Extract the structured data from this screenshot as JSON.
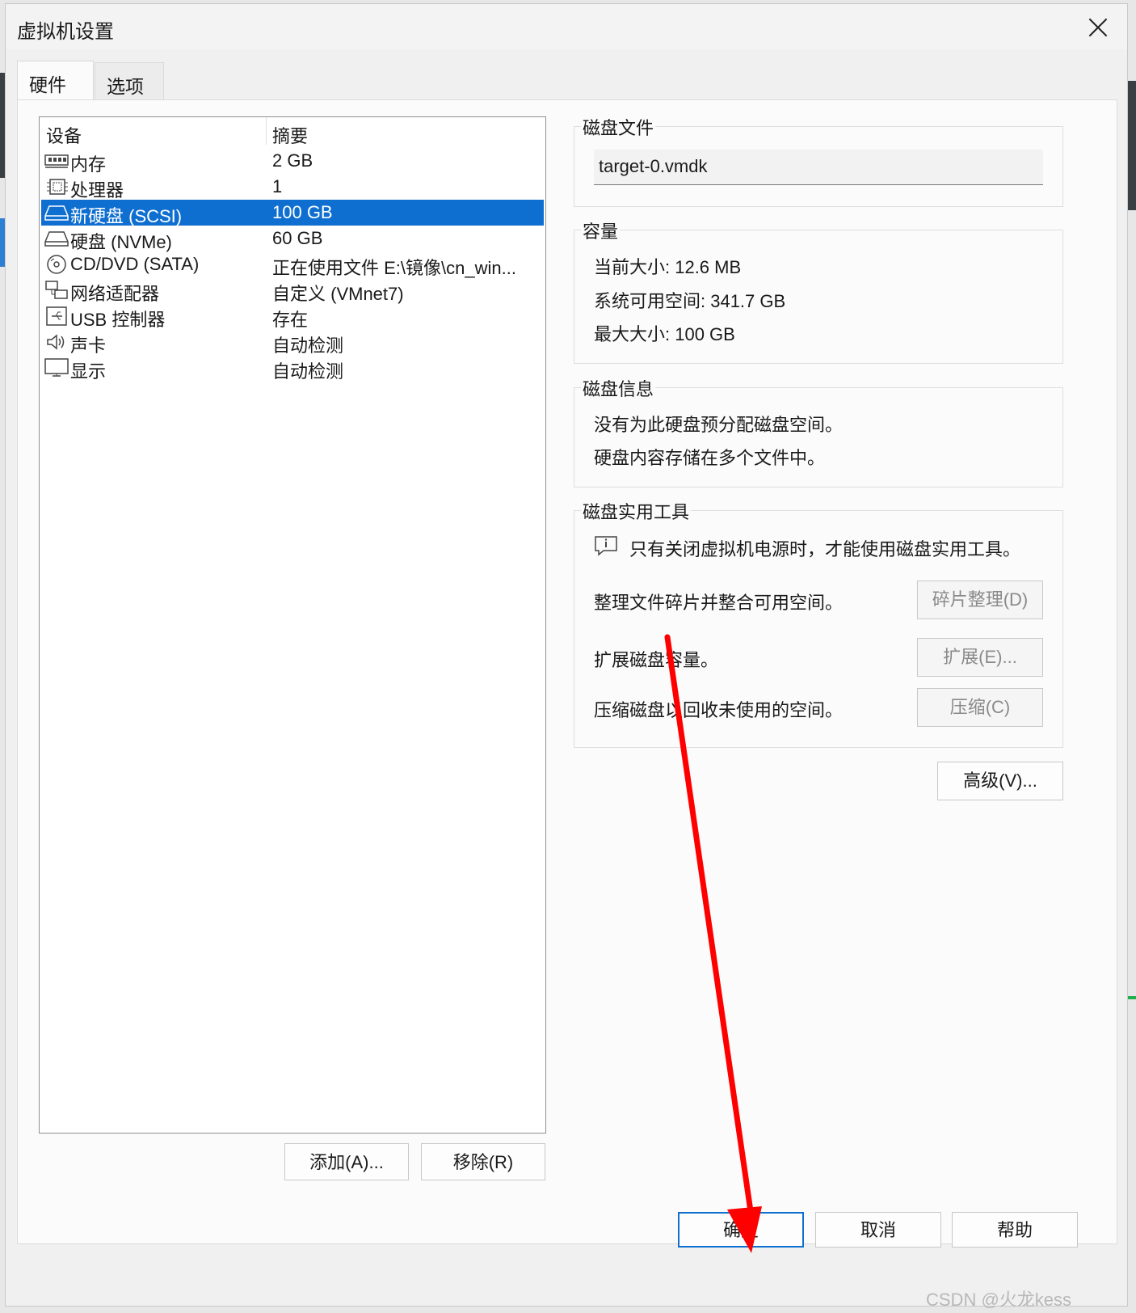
{
  "window": {
    "title": "虚拟机设置"
  },
  "tabs": [
    {
      "label": "硬件",
      "active": true
    },
    {
      "label": "选项",
      "active": false
    }
  ],
  "device_list": {
    "headers": {
      "device": "设备",
      "summary": "摘要"
    },
    "rows": [
      {
        "icon": "memory-icon",
        "name": "内存",
        "summary": "2 GB",
        "selected": false
      },
      {
        "icon": "processor-icon",
        "name": "处理器",
        "summary": "1",
        "selected": false
      },
      {
        "icon": "hard-disk-icon",
        "name": "新硬盘 (SCSI)",
        "summary": "100 GB",
        "selected": true
      },
      {
        "icon": "hard-disk-icon",
        "name": "硬盘 (NVMe)",
        "summary": "60 GB",
        "selected": false
      },
      {
        "icon": "cd-dvd-icon",
        "name": "CD/DVD (SATA)",
        "summary": "正在使用文件 E:\\镜像\\cn_win...",
        "selected": false
      },
      {
        "icon": "network-adapter-icon",
        "name": "网络适配器",
        "summary": "自定义 (VMnet7)",
        "selected": false
      },
      {
        "icon": "usb-icon",
        "name": "USB 控制器",
        "summary": "存在",
        "selected": false
      },
      {
        "icon": "sound-card-icon",
        "name": "声卡",
        "summary": "自动检测",
        "selected": false
      },
      {
        "icon": "display-icon",
        "name": "显示",
        "summary": "自动检测",
        "selected": false
      }
    ]
  },
  "list_buttons": {
    "add": "添加(A)...",
    "remove": "移除(R)"
  },
  "disk_file": {
    "title": "磁盘文件",
    "value": "target-0.vmdk"
  },
  "capacity": {
    "title": "容量",
    "current_size": "当前大小: 12.6 MB",
    "available_space": "系统可用空间: 341.7 GB",
    "max_size": "最大大小: 100 GB"
  },
  "disk_info": {
    "title": "磁盘信息",
    "line1": "没有为此硬盘预分配磁盘空间。",
    "line2": "硬盘内容存储在多个文件中。"
  },
  "disk_utilities": {
    "title": "磁盘实用工具",
    "notice": "只有关闭虚拟机电源时，才能使用磁盘实用工具。",
    "defrag_text": "整理文件碎片并整合可用空间。",
    "defrag_button": "碎片整理(D)",
    "expand_text": "扩展磁盘容量。",
    "expand_button": "扩展(E)...",
    "compact_text": "压缩磁盘以回收未使用的空间。",
    "compact_button": "压缩(C)"
  },
  "advanced_button": "高级(V)...",
  "footer": {
    "ok": "确定",
    "cancel": "取消",
    "help": "帮助"
  },
  "annotation": {
    "arrow_color": "#ff0000"
  },
  "watermark": "CSDN @火龙kess"
}
